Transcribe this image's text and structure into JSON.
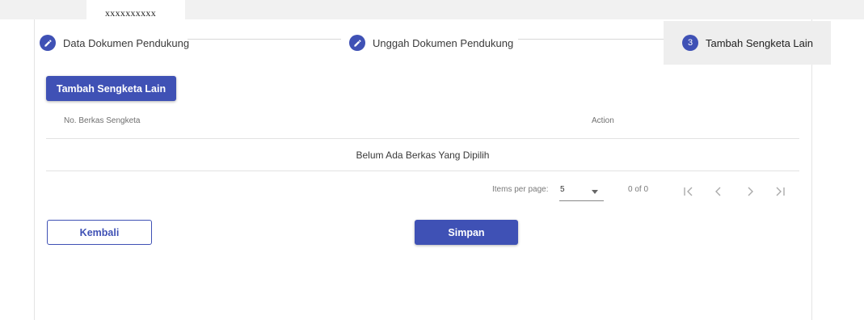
{
  "tab": {
    "label": "xxxxxxxxxx"
  },
  "stepper": {
    "steps": [
      {
        "label": "Data Dokumen Pendukung",
        "icon": "edit-icon",
        "state": "done"
      },
      {
        "label": "Unggah Dokumen Pendukung",
        "icon": "edit-icon",
        "state": "done"
      },
      {
        "label": "Tambah Sengketa Lain",
        "number": "3",
        "state": "active"
      }
    ]
  },
  "actions": {
    "add_label": "Tambah Sengketa Lain"
  },
  "table": {
    "columns": [
      "No. Berkas Sengketa",
      "Action"
    ],
    "empty_message": "Belum Ada Berkas Yang Dipilih"
  },
  "paginator": {
    "items_per_page_label": "Items per page:",
    "items_per_page_value": "5",
    "range_label": "0 of 0",
    "icons": [
      "first-page-icon",
      "previous-page-icon",
      "next-page-icon",
      "last-page-icon"
    ]
  },
  "footer": {
    "back_label": "Kembali",
    "save_label": "Simpan"
  },
  "colors": {
    "primary": "#3f51b5",
    "active_step_bg": "#eeeeee"
  }
}
